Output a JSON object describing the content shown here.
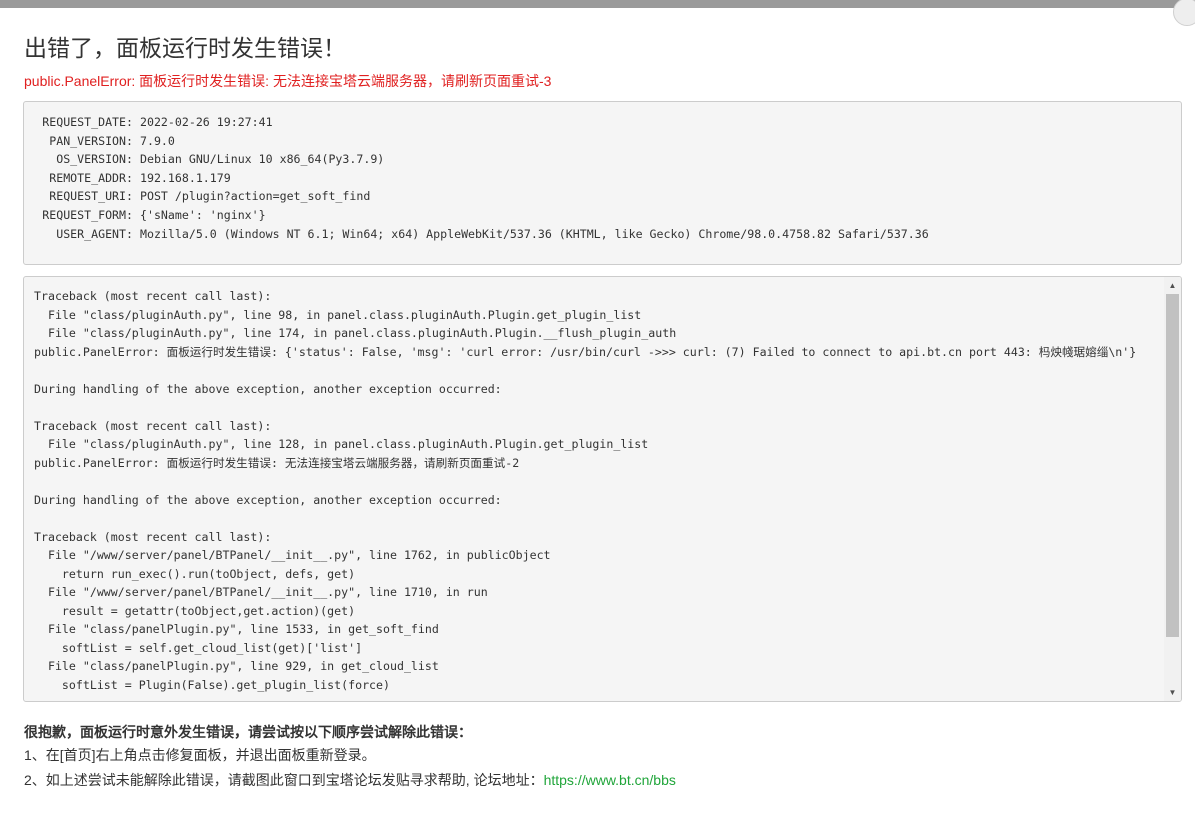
{
  "dialog": {
    "title": "出错了，面板运行时发生错误！",
    "error_message": "public.PanelError: 面板运行时发生错误: 无法连接宝塔云端服务器，请刷新页面重试-3"
  },
  "request_info": [
    {
      "key": "REQUEST_DATE:",
      "value": "2022-02-26 19:27:41"
    },
    {
      "key": "PAN_VERSION:",
      "value": "7.9.0"
    },
    {
      "key": "OS_VERSION:",
      "value": "Debian GNU/Linux 10 x86_64(Py3.7.9)"
    },
    {
      "key": "REMOTE_ADDR:",
      "value": "192.168.1.179"
    },
    {
      "key": "REQUEST_URI:",
      "value": "POST /plugin?action=get_soft_find"
    },
    {
      "key": "REQUEST_FORM:",
      "value": "{'sName': 'nginx'}"
    },
    {
      "key": "USER_AGENT:",
      "value": "Mozilla/5.0 (Windows NT 6.1; Win64; x64) AppleWebKit/537.36 (KHTML, like Gecko) Chrome/98.0.4758.82 Safari/537.36"
    }
  ],
  "traceback": [
    "Traceback (most recent call last):",
    "  File \"class/pluginAuth.py\", line 98, in panel.class.pluginAuth.Plugin.get_plugin_list",
    "  File \"class/pluginAuth.py\", line 174, in panel.class.pluginAuth.Plugin.__flush_plugin_auth",
    "public.PanelError: 面板运行时发生错误: {'status': False, 'msg': 'curl error: /usr/bin/curl ->>> curl: (7) Failed to connect to api.bt.cn port 443: 杩炴帴琚嫆缁\\n'}",
    "",
    "During handling of the above exception, another exception occurred:",
    "",
    "Traceback (most recent call last):",
    "  File \"class/pluginAuth.py\", line 128, in panel.class.pluginAuth.Plugin.get_plugin_list",
    "public.PanelError: 面板运行时发生错误: 无法连接宝塔云端服务器，请刷新页面重试-2",
    "",
    "During handling of the above exception, another exception occurred:",
    "",
    "Traceback (most recent call last):",
    "  File \"/www/server/panel/BTPanel/__init__.py\", line 1762, in publicObject",
    "    return run_exec().run(toObject, defs, get)",
    "  File \"/www/server/panel/BTPanel/__init__.py\", line 1710, in run",
    "    result = getattr(toObject,get.action)(get)",
    "  File \"class/panelPlugin.py\", line 1533, in get_soft_find",
    "    softList = self.get_cloud_list(get)['list']",
    "  File \"class/panelPlugin.py\", line 929, in get_cloud_list",
    "    softList = Plugin(False).get_plugin_list(force)"
  ],
  "help": {
    "title": "很抱歉，面板运行时意外发生错误，请尝试按以下顺序尝试解除此错误：",
    "step1": "1、在[首页]右上角点击修复面板，并退出面板重新登录。",
    "step2_prefix": "2、如上述尝试未能解除此错误，请截图此窗口到宝塔论坛发贴寻求帮助, 论坛地址：",
    "forum_link": "https://www.bt.cn/bbs"
  },
  "colors": {
    "error": "#e02020",
    "link": "#20a53a"
  },
  "icons": {
    "close": "close-icon",
    "scroll_up": "arrow-up-icon",
    "scroll_down": "arrow-down-icon"
  }
}
